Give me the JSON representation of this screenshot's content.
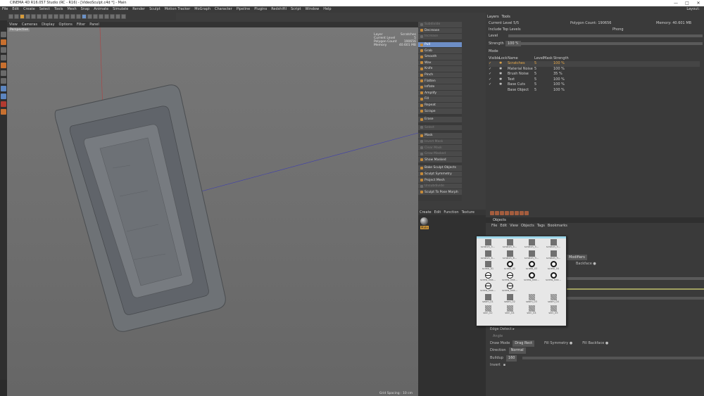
{
  "window": {
    "title": "CINEMA 4D R16.057 Studio (RC - R16) - [VideoSculpt.c4d *] - Main",
    "controls": [
      "—",
      "□",
      "✕"
    ]
  },
  "menubar": {
    "items": [
      "File",
      "Edit",
      "Create",
      "Select",
      "Tools",
      "Mesh",
      "Snap",
      "Animate",
      "Simulate",
      "Render",
      "Sculpt",
      "Motion Tracker",
      "MoGraph",
      "Character",
      "Pipeline",
      "Plugins",
      "RedshiftI",
      "Script",
      "Window",
      "Help"
    ],
    "layout": "Layout:"
  },
  "viewport": {
    "menu": [
      "View",
      "Cameras",
      "Display",
      "Options",
      "Filter",
      "Panel"
    ],
    "label": "Perspective",
    "hud": [
      {
        "k": "Layer",
        "v": "Scratches"
      },
      {
        "k": "Current Level",
        "v": "5"
      },
      {
        "k": "Polygon Count",
        "v": "190656"
      },
      {
        "k": "Memory",
        "v": "40.601 MB"
      }
    ],
    "grid_spacing": "Grid Spacing : 10 cm"
  },
  "brushes": {
    "group1": [
      {
        "label": "Subdivide",
        "dim": true
      },
      {
        "label": "Decrease",
        "dim": false
      },
      {
        "label": "Increase",
        "dim": true
      }
    ],
    "group2": [
      {
        "label": "Pull",
        "selected": true
      },
      {
        "label": "Grab"
      },
      {
        "label": "Smooth"
      },
      {
        "label": "Wax"
      },
      {
        "label": "Knife"
      },
      {
        "label": "Pinch"
      },
      {
        "label": "Flatten"
      },
      {
        "label": "Inflate"
      },
      {
        "label": "Amplify"
      },
      {
        "label": "Fill"
      },
      {
        "label": "Repeat"
      },
      {
        "label": "Scrape"
      }
    ],
    "group3": [
      {
        "label": "Erase"
      }
    ],
    "group4": [
      {
        "label": "Select",
        "dim": true
      }
    ],
    "group5": [
      {
        "label": "Mask"
      },
      {
        "label": "Invert Mask",
        "dim": true
      },
      {
        "label": "Clear Mask",
        "dim": true
      },
      {
        "label": "Grow Masked",
        "dim": true
      },
      {
        "label": "Show Masked"
      }
    ],
    "group6": [
      {
        "label": "Bake Sculpt Objects"
      },
      {
        "label": "Sculpt Symmetry"
      },
      {
        "label": "Project Mesh"
      },
      {
        "label": "Unsubdivide",
        "dim": true
      },
      {
        "label": "Sculpt To Pose Morph"
      }
    ]
  },
  "material_manager": {
    "menu": [
      "Create",
      "Edit",
      "Function",
      "Texture"
    ],
    "material_name": "Mate"
  },
  "layers_panel": {
    "tabs": [
      "Layers",
      "Tools"
    ],
    "current_level": "Current Level 5/5",
    "polygon_count": "Polygon Count: 190656",
    "memory": "Memory: 40.601 MB",
    "include_top_levels": "Include Top Levels",
    "phong": "Phong",
    "level_label": "Level",
    "strength_label": "Strength",
    "strength_value": "100 %",
    "mode_label": "Mode",
    "columns": [
      "Visible",
      "Lock",
      "Name",
      "Level",
      "Mask",
      "Strength"
    ],
    "rows": [
      {
        "vis": "✓",
        "lock": "✱",
        "name": "Scratches",
        "level": "5",
        "mask": "",
        "strength": "100 %",
        "selected": true
      },
      {
        "vis": "✓",
        "lock": "✱",
        "name": "Material Noise",
        "level": "5",
        "mask": "",
        "strength": "100 %"
      },
      {
        "vis": "✓",
        "lock": "✱",
        "name": "Brush Noise",
        "level": "5",
        "mask": "",
        "strength": "35 %"
      },
      {
        "vis": "✓",
        "lock": "✱",
        "name": "Text",
        "level": "5",
        "mask": "",
        "strength": "100 %"
      },
      {
        "vis": "✓",
        "lock": "✱",
        "name": "Base Cuts",
        "level": "5",
        "mask": "",
        "strength": "100 %"
      },
      {
        "vis": "",
        "lock": "",
        "name": "Base Object",
        "level": "5",
        "mask": "",
        "strength": "100 %"
      }
    ]
  },
  "objects_panel": {
    "title": "Objects",
    "menu": [
      "File",
      "Edit",
      "View",
      "Objects",
      "Tags",
      "Bookmarks"
    ],
    "tab_modifiers": "Modifiers",
    "backface": "Backface ●",
    "edge_detect": "Edge Detect ▸",
    "angle": "Angle",
    "draw_mode_label": "Draw Mode",
    "draw_mode_value": "Drag Rect",
    "fill_symmetry": "Fill Symmetry ●",
    "fill_backface": "Fill Backface ●",
    "direction_label": "Direction",
    "direction_value": "Normal",
    "buildup_label": "Buildup",
    "buildup_value": "160",
    "invert_label": "Invert"
  },
  "stamp_popup": {
    "items": [
      {
        "label": "scratch_5...",
        "kind": "plain"
      },
      {
        "label": "scratch_5...",
        "kind": "plain"
      },
      {
        "label": "scratch_5...",
        "kind": "plain"
      },
      {
        "label": "scratch_5...",
        "kind": "plain"
      },
      {
        "label": "scratch_6...",
        "kind": "plain"
      },
      {
        "label": "scratch_6...",
        "kind": "plain"
      },
      {
        "label": "scratch_9...",
        "kind": "plain"
      },
      {
        "label": "scratch_9...",
        "kind": "plain"
      },
      {
        "label": "screw_01",
        "kind": "plain"
      },
      {
        "label": "screw_02",
        "kind": "circ"
      },
      {
        "label": "screw_03",
        "kind": "circ"
      },
      {
        "label": "screw_04",
        "kind": "circ"
      },
      {
        "label": "screw_hea...",
        "kind": "line"
      },
      {
        "label": "screw_hea...",
        "kind": "line"
      },
      {
        "label": "screw_hea...",
        "kind": "circ"
      },
      {
        "label": "screw_hea...",
        "kind": "circ"
      },
      {
        "label": "screw_hea...",
        "kind": "line"
      },
      {
        "label": "screw_hea...",
        "kind": "line"
      },
      {
        "label": "",
        "kind": "none"
      },
      {
        "label": "",
        "kind": "none"
      },
      {
        "label": "seam_01",
        "kind": "plain"
      },
      {
        "label": "seam_02",
        "kind": "plain"
      },
      {
        "label": "seam_03",
        "kind": "noise"
      },
      {
        "label": "seam_04",
        "kind": "noise"
      },
      {
        "label": "skin_02",
        "kind": "noise"
      },
      {
        "label": "skin_04",
        "kind": "noise"
      },
      {
        "label": "skin_04",
        "kind": "noise"
      },
      {
        "label": "skin_05",
        "kind": "noise"
      }
    ]
  }
}
